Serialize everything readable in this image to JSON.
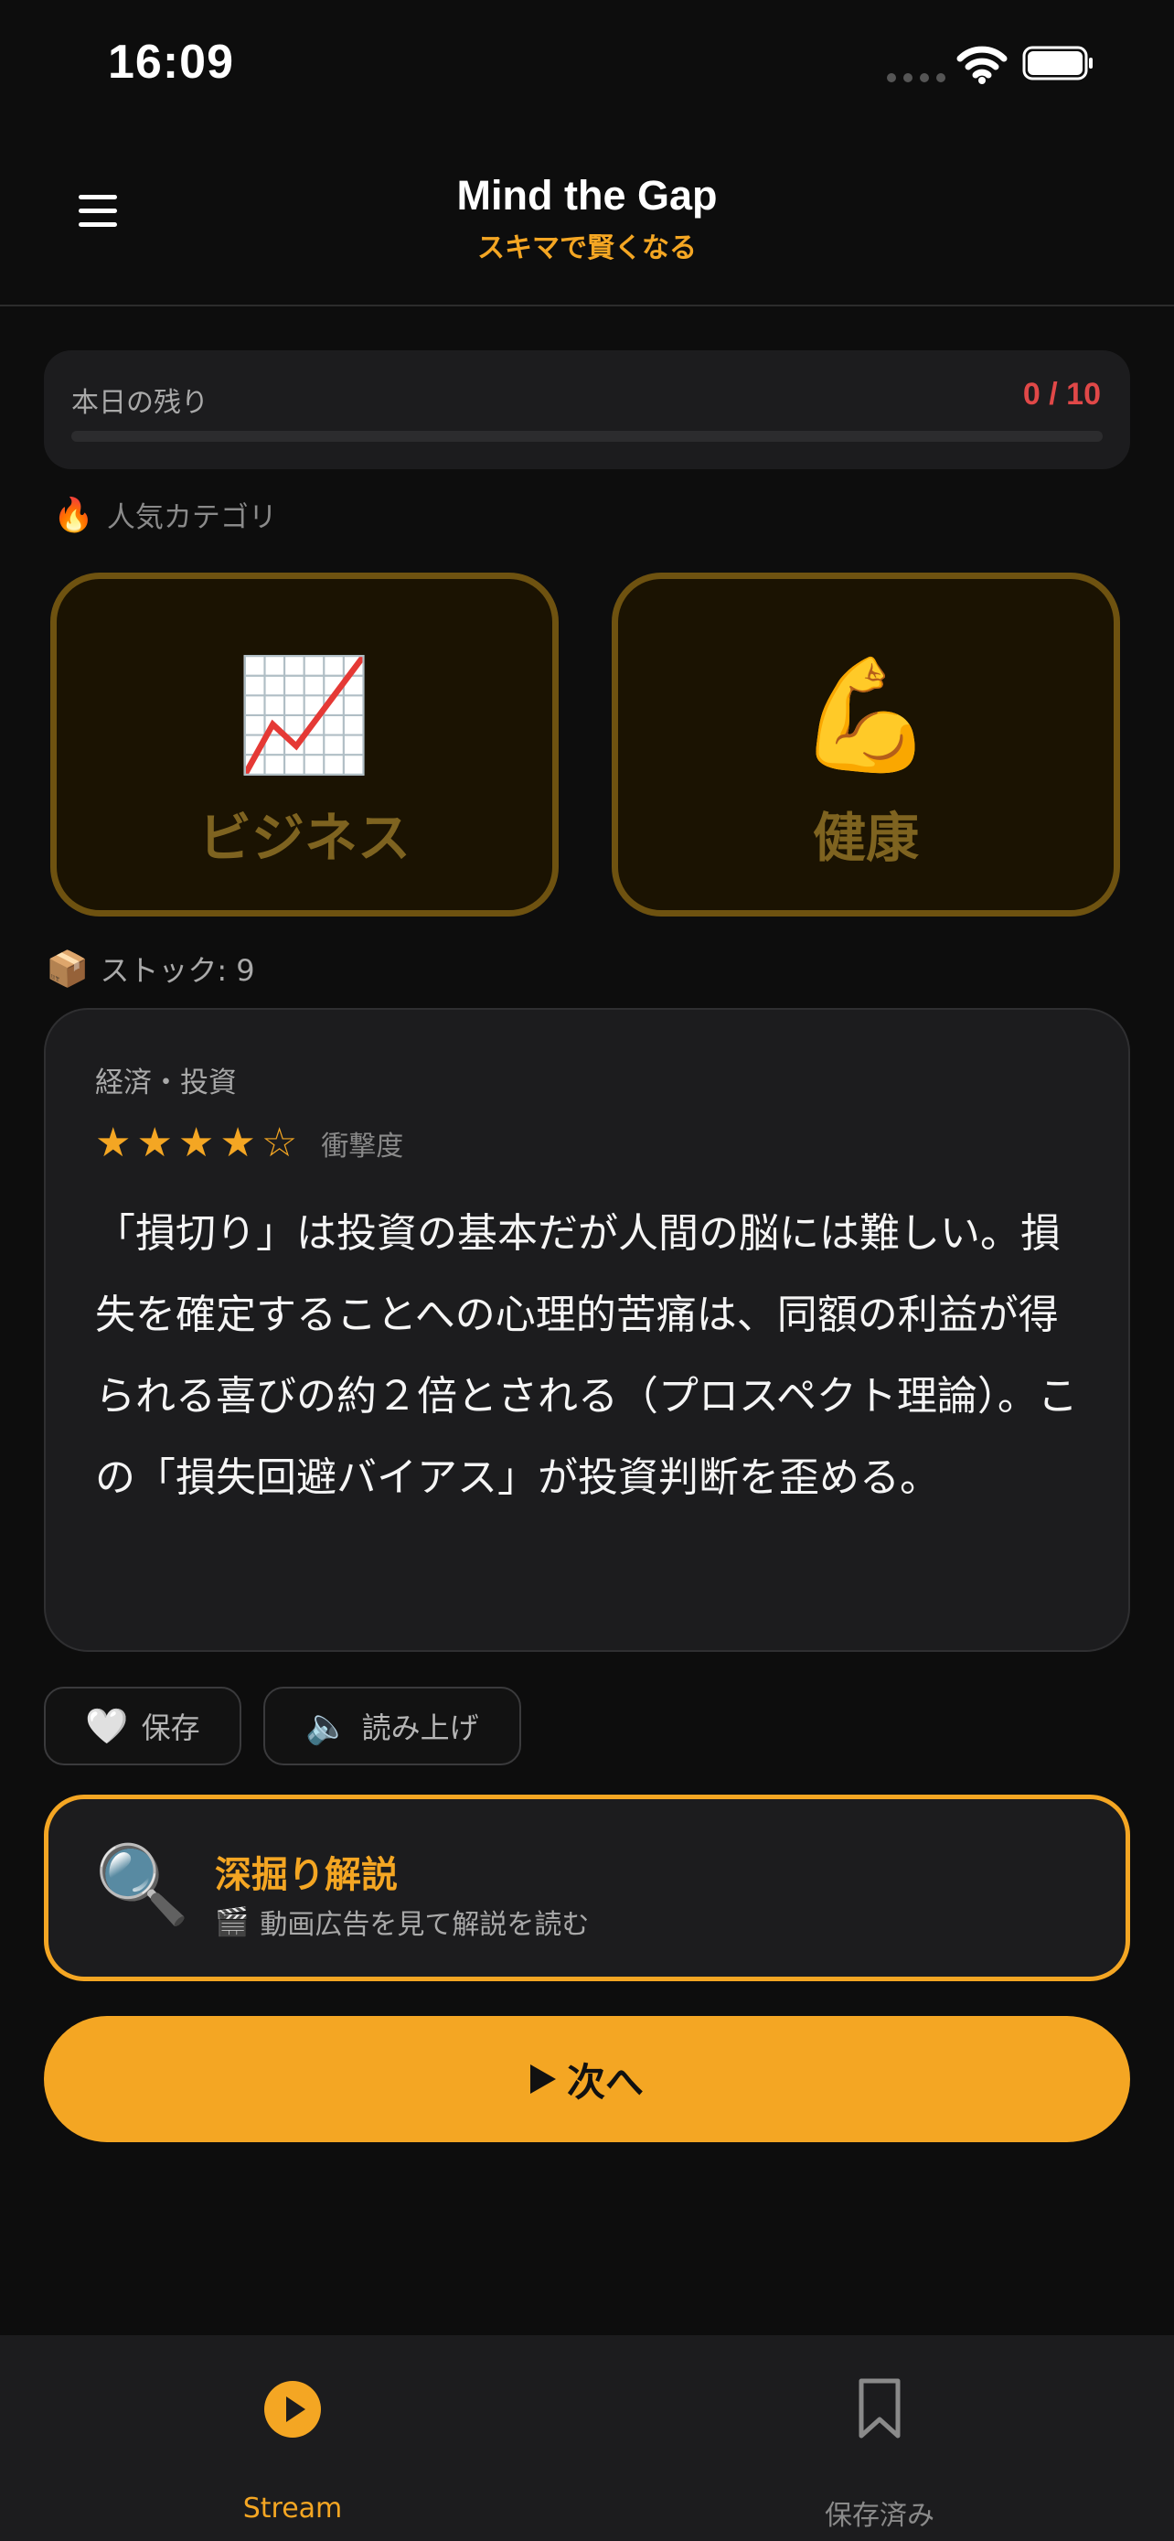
{
  "status_bar": {
    "time": "16:09"
  },
  "header": {
    "title": "Mind the Gap",
    "subtitle": "スキマで賢くなる"
  },
  "quota": {
    "label": "本日の残り",
    "value": "0 / 10",
    "fraction_used": 0
  },
  "popular": {
    "icon": "🔥",
    "label": "人気カテゴリ"
  },
  "categories": [
    {
      "icon": "📈",
      "label": "ビジネス"
    },
    {
      "icon": "💪",
      "label": "健康"
    }
  ],
  "stock": {
    "icon": "📦",
    "label": "ストック: 9"
  },
  "card": {
    "category": "経済・投資",
    "rating": 4,
    "rating_max": 5,
    "stars": [
      "★",
      "★",
      "★",
      "★",
      "☆"
    ],
    "impact_label": "衝撃度",
    "body": "「損切り」は投資の基本だが人間の脳には難しい。損失を確定することへの心理的苦痛は、同額の利益が得られる喜びの約２倍とされる（プロスペクト理論）。この「損失回避バイアス」が投資判断を歪める。"
  },
  "actions": {
    "save": {
      "icon": "🤍",
      "label": "保存"
    },
    "read": {
      "icon": "🔈",
      "label": "読み上げ"
    }
  },
  "deep_dive": {
    "icon": "🔍",
    "title": "深掘り解説",
    "sub_icon": "🎬",
    "subtitle": "動画広告を見て解説を読む"
  },
  "next_button": {
    "label": "次へ"
  },
  "tabs": [
    {
      "label": "Stream",
      "icon": "play-circle-icon",
      "active": true
    },
    {
      "label": "保存済み",
      "icon": "bookmark-icon",
      "active": false
    }
  ],
  "colors": {
    "accent": "#f4a623",
    "danger": "#e04848",
    "background": "#0d0d0d",
    "surface": "#1c1c1e"
  }
}
